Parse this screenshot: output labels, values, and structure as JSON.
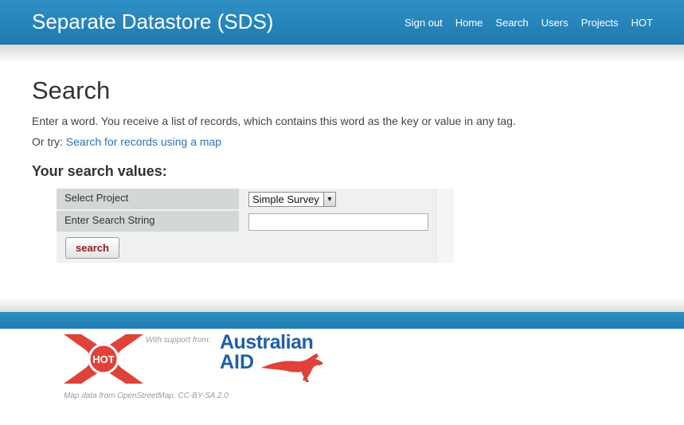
{
  "header": {
    "brand": "Separate Datastore (SDS)",
    "nav": [
      "Sign out",
      "Home",
      "Search",
      "Users",
      "Projects",
      "HOT"
    ]
  },
  "main": {
    "title": "Search",
    "intro": "Enter a word. You receive a list of records, which contains this word as the key or value in any tag.",
    "alt_prefix": "Or try: ",
    "alt_link": "Search for records using a map",
    "section_title": "Your search values:",
    "form": {
      "select_project_label": "Select Project",
      "select_project_value": "Simple Survey",
      "search_string_label": "Enter Search String",
      "search_string_value": "",
      "search_button": "search"
    }
  },
  "footer": {
    "hot_logo_text": "HOT",
    "support_text": "With support from:",
    "aid_logo_line1": "Australian",
    "aid_logo_line2": "AID",
    "credits": "Map data from OpenStreetMap, CC-BY-SA 2.0"
  },
  "colors": {
    "header_blue": "#2384bb",
    "link_blue": "#2a72b8",
    "button_text": "#8a1c1c",
    "hot_red": "#e0413a",
    "aid_blue": "#1f5fa8"
  },
  "icons": [
    "dropdown-arrow-icon",
    "hot-logo",
    "kangaroo-icon"
  ]
}
